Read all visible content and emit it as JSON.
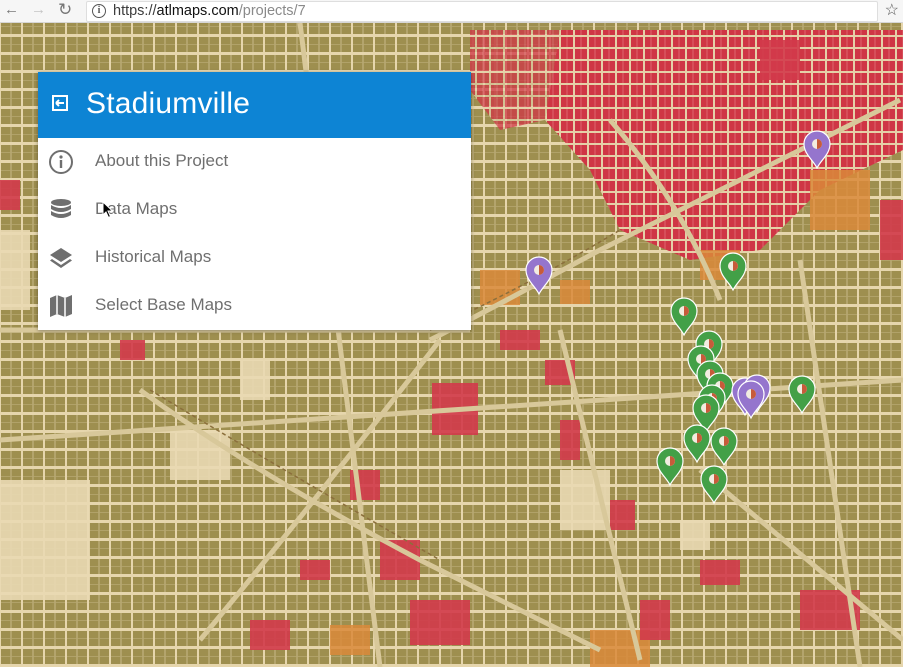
{
  "browser": {
    "url_scheme": "https://",
    "url_host": "atlmaps.com",
    "url_path": "/projects/7",
    "back_icon": "back-arrow-icon",
    "forward_icon": "forward-arrow-icon",
    "reload_icon": "reload-icon",
    "bookmark_icon": "star-icon"
  },
  "panel": {
    "title": "Stadiumville",
    "header_color": "#0d84d4",
    "exit_icon": "exit-icon",
    "items": [
      {
        "label": "About this Project",
        "icon": "info-circle-icon"
      },
      {
        "label": "Data Maps",
        "icon": "database-icon"
      },
      {
        "label": "Historical Maps",
        "icon": "layers-icon"
      },
      {
        "label": "Select Base Maps",
        "icon": "map-icon"
      }
    ]
  },
  "markers": {
    "green_color": "#43a047",
    "purple_color": "#9575cd"
  }
}
